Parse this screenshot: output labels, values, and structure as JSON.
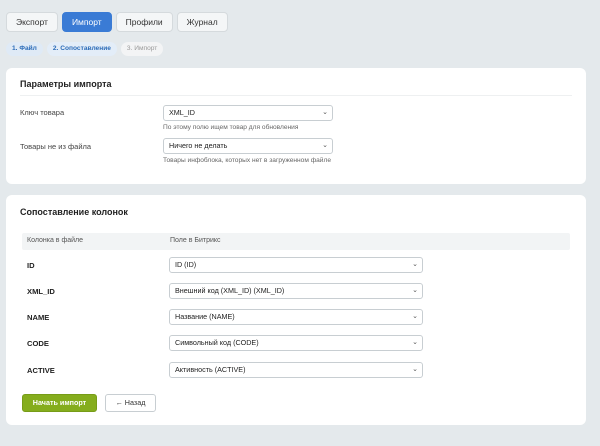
{
  "tabs": [
    {
      "label": "Экспорт",
      "active": false
    },
    {
      "label": "Импорт",
      "active": true
    },
    {
      "label": "Профили",
      "active": false
    },
    {
      "label": "Журнал",
      "active": false
    }
  ],
  "steps": [
    {
      "label": "1. Файл",
      "state": "done"
    },
    {
      "label": "2. Сопоставление",
      "state": "current"
    },
    {
      "label": "3. Импорт",
      "state": "pending"
    }
  ],
  "params": {
    "title": "Параметры импорта",
    "product_key": {
      "label": "Ключ товара",
      "value": "XML_ID",
      "hint": "По этому полю ищем товар для обновления"
    },
    "missing_items": {
      "label": "Товары не из файла",
      "value": "Ничего не делать",
      "hint": "Товары инфоблока, которых нет в загруженном файле"
    }
  },
  "mapping": {
    "title": "Сопоставление колонок",
    "col_file": "Колонка в файле",
    "col_bitrix": "Поле в Битрикс",
    "rows": [
      {
        "column": "ID",
        "field": "ID (ID)"
      },
      {
        "column": "XML_ID",
        "field": "Внешний код (XML_ID) (XML_ID)"
      },
      {
        "column": "NAME",
        "field": "Название (NAME)"
      },
      {
        "column": "CODE",
        "field": "Символьный код (CODE)"
      },
      {
        "column": "ACTIVE",
        "field": "Активность (ACTIVE)"
      }
    ]
  },
  "actions": {
    "start_label": "Начать импорт",
    "back_label": "← Назад"
  },
  "icons": {
    "select_arrow": "chevron-down-icon"
  },
  "colors": {
    "accent": "#3a7bd5",
    "primary_button": "#85ad1d",
    "background": "#e4e9ec"
  }
}
